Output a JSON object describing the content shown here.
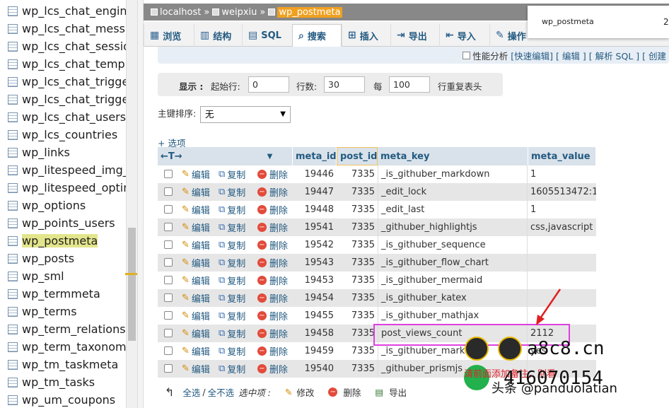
{
  "sidebar": {
    "items": [
      {
        "label": "wp_lcs_chat_engine",
        "active": false
      },
      {
        "label": "wp_lcs_chat_messag",
        "active": false
      },
      {
        "label": "wp_lcs_chat_session",
        "active": false
      },
      {
        "label": "wp_lcs_chat_templa",
        "active": false
      },
      {
        "label": "wp_lcs_chat_trigger",
        "active": false
      },
      {
        "label": "wp_lcs_chat_trigger",
        "active": false
      },
      {
        "label": "wp_lcs_chat_users",
        "active": false
      },
      {
        "label": "wp_lcs_countries",
        "active": false
      },
      {
        "label": "wp_links",
        "active": false
      },
      {
        "label": "wp_litespeed_img_c",
        "active": false
      },
      {
        "label": "wp_litespeed_optim",
        "active": false
      },
      {
        "label": "wp_options",
        "active": false
      },
      {
        "label": "wp_points_users",
        "active": false
      },
      {
        "label": "wp_postmeta",
        "active": true
      },
      {
        "label": "wp_posts",
        "active": false
      },
      {
        "label": "wp_sml",
        "active": false
      },
      {
        "label": "wp_termmeta",
        "active": false
      },
      {
        "label": "wp_terms",
        "active": false
      },
      {
        "label": "wp_term_relationsh",
        "active": false
      },
      {
        "label": "wp_term_taxonomy",
        "active": false
      },
      {
        "label": "wp_tm_taskmeta",
        "active": false
      },
      {
        "label": "wp_tm_tasks",
        "active": false
      },
      {
        "label": "wp_um_coupons",
        "active": false
      }
    ]
  },
  "breadcrumb": {
    "server": "localhost",
    "database": "weipxiu",
    "table": "wp_postmeta"
  },
  "tabs": [
    {
      "label": "浏览",
      "icon": "browse-icon",
      "active": false
    },
    {
      "label": "结构",
      "icon": "structure-icon",
      "active": false
    },
    {
      "label": "SQL",
      "icon": "sql-icon",
      "active": false
    },
    {
      "label": "搜索",
      "icon": "search-icon",
      "active": true
    },
    {
      "label": "插入",
      "icon": "insert-icon",
      "active": false
    },
    {
      "label": "导出",
      "icon": "export-icon",
      "active": false
    },
    {
      "label": "导入",
      "icon": "import-icon",
      "active": false
    },
    {
      "label": "操作",
      "icon": "wrench-icon",
      "active": false
    }
  ],
  "popup": {
    "title": "wp_postmeta",
    "extra": "2"
  },
  "sql_links": {
    "profiling": "性能分析",
    "quick_edit": "[快速编辑]",
    "edit": "[ 编辑 ]",
    "explain": "[ 解析 SQL ]",
    "create": "[ 创建"
  },
  "nav": {
    "show_label": "显示 :",
    "start_label": "起始行:",
    "start_value": "0",
    "rows_label": "行数:",
    "rows_value": "30",
    "every_label": "每",
    "every_value": "100",
    "repeat_label": "行重复表头"
  },
  "sort": {
    "label": "主键排序:",
    "value": "无"
  },
  "options_label": "+ 选项",
  "columns": [
    "meta_id",
    "post_id",
    "meta_key",
    "meta_value"
  ],
  "actions": {
    "edit": "编辑",
    "copy": "复制",
    "delete": "删除"
  },
  "rows": [
    {
      "meta_id": "19446",
      "post_id": "7335",
      "meta_key": "_is_githuber_markdown",
      "meta_value": "1"
    },
    {
      "meta_id": "19447",
      "post_id": "7335",
      "meta_key": "_edit_lock",
      "meta_value": "1605513472:1"
    },
    {
      "meta_id": "19448",
      "post_id": "7335",
      "meta_key": "_edit_last",
      "meta_value": "1"
    },
    {
      "meta_id": "19541",
      "post_id": "7335",
      "meta_key": "_githuber_highlightjs",
      "meta_value": "css,javascript"
    },
    {
      "meta_id": "19542",
      "post_id": "7335",
      "meta_key": "_is_githuber_sequence",
      "meta_value": ""
    },
    {
      "meta_id": "19543",
      "post_id": "7335",
      "meta_key": "_is_githuber_flow_chart",
      "meta_value": ""
    },
    {
      "meta_id": "19453",
      "post_id": "7335",
      "meta_key": "_is_githuber_mermaid",
      "meta_value": ""
    },
    {
      "meta_id": "19454",
      "post_id": "7335",
      "meta_key": "_is_githuber_katex",
      "meta_value": ""
    },
    {
      "meta_id": "19455",
      "post_id": "7335",
      "meta_key": "_is_githuber_mathjax",
      "meta_value": ""
    },
    {
      "meta_id": "19458",
      "post_id": "7335",
      "meta_key": "post_views_count",
      "meta_value": "2112"
    },
    {
      "meta_id": "19459",
      "post_id": "7335",
      "meta_key": "_is_githuber_markd",
      "meta_value": "yes"
    },
    {
      "meta_id": "19540",
      "post_id": "7335",
      "meta_key": "_githuber_prismjs",
      "meta_value": ""
    }
  ],
  "bottom": {
    "check_all": "全选",
    "slash": "/",
    "uncheck_all": "全不选",
    "selected": "选中项 :",
    "edit": "修改",
    "delete": "删除",
    "export": "导出"
  },
  "watermark": {
    "site": "a8c8.cn",
    "note": "请前面添加备注，别看",
    "qq": "416070154",
    "author": "头条 @panduolatian"
  }
}
